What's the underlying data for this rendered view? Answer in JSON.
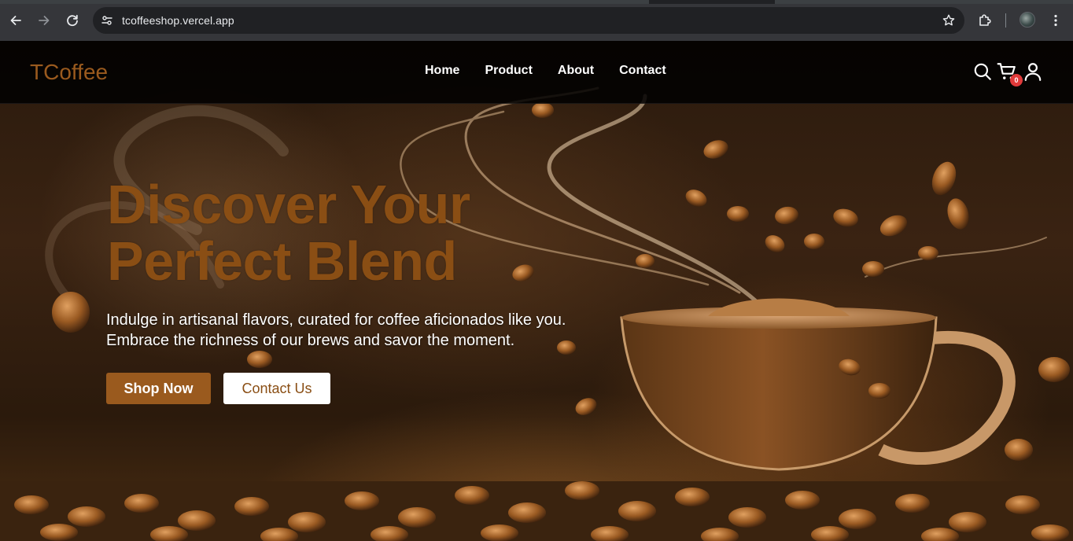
{
  "browser": {
    "url": "tcoffeeshop.vercel.app",
    "icons": {
      "back": "arrow-left-icon",
      "forward": "arrow-right-icon",
      "reload": "reload-icon",
      "site_info": "tune-icon",
      "bookmark": "star-icon",
      "extensions": "puzzle-icon",
      "profile": "avatar",
      "menu": "kebab-menu-icon"
    }
  },
  "navbar": {
    "logo": "TCoffee",
    "links": [
      "Home",
      "Product",
      "About",
      "Contact"
    ],
    "cart_count": "0",
    "icons": [
      "search-icon",
      "cart-icon",
      "user-icon"
    ]
  },
  "hero": {
    "title_line1": "Discover Your",
    "title_line2": "Perfect Blend",
    "subtitle_line1": "Indulge in artisanal flavors, curated for coffee aficionados like you.",
    "subtitle_line2": "Embrace the richness of our brews and savor the moment.",
    "primary_button": "Shop Now",
    "secondary_button": "Contact Us"
  },
  "colors": {
    "brand": "#9a5a1e",
    "title": "#8a4e14",
    "badge": "#e03a3a",
    "chrome": "#35363a"
  }
}
